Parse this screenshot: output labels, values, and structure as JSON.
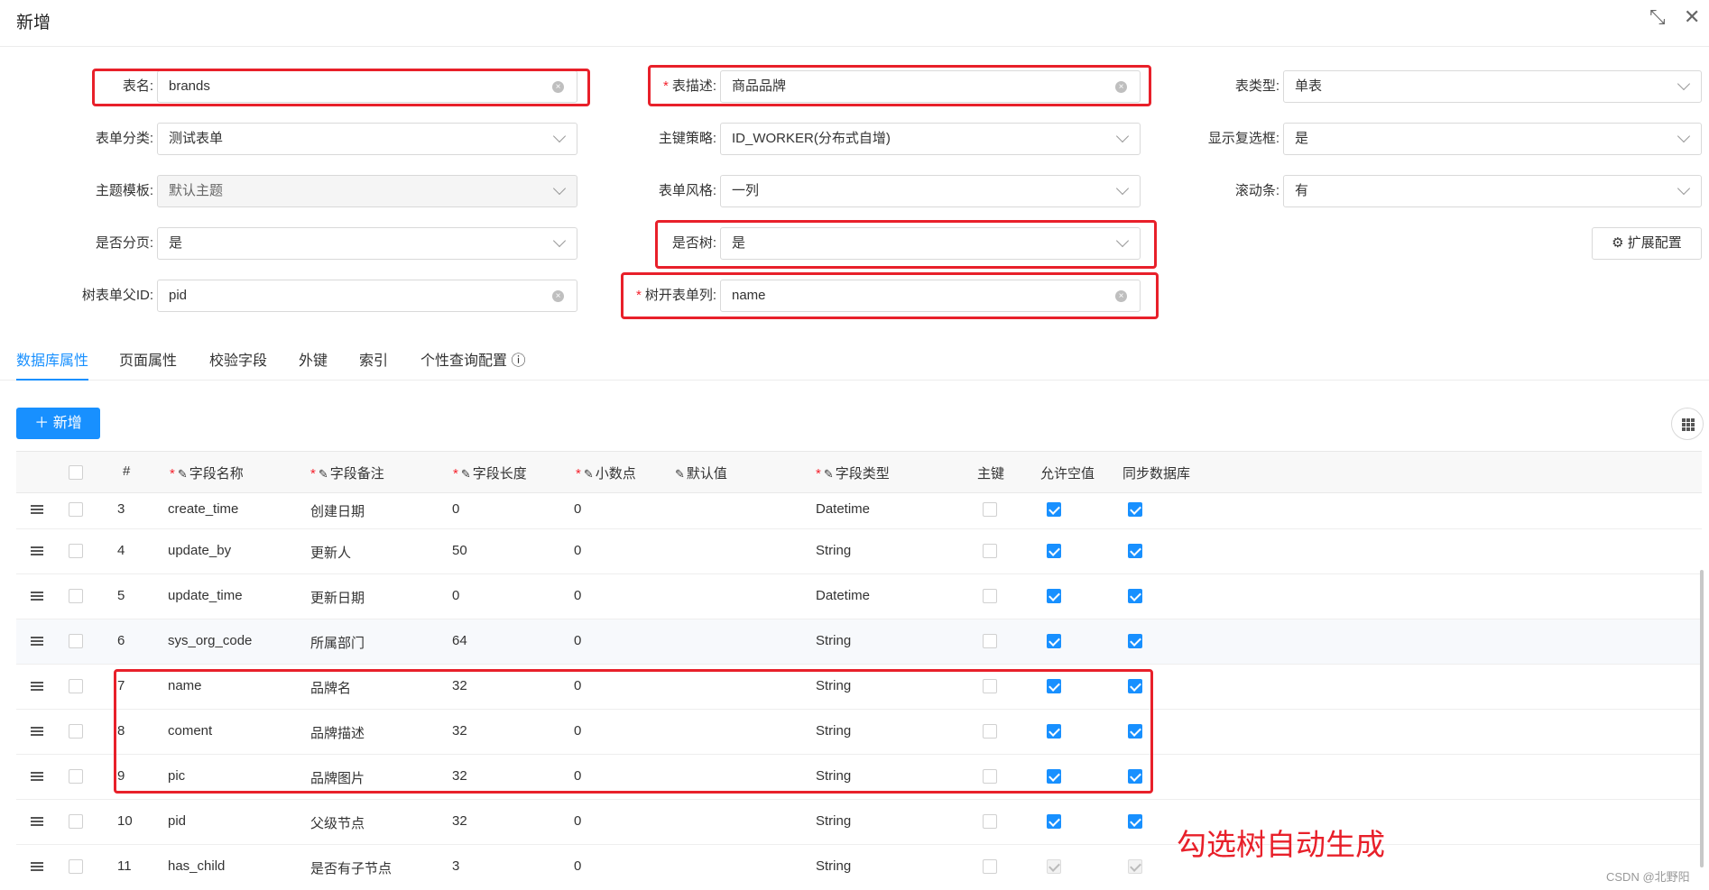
{
  "modal": {
    "title": "新增"
  },
  "form": {
    "table_name": {
      "label": "表名:",
      "value": "brands"
    },
    "table_desc": {
      "label": "表描述:",
      "value": "商品品牌"
    },
    "table_type": {
      "label": "表类型:",
      "value": "单表"
    },
    "form_category": {
      "label": "表单分类:",
      "value": "测试表单"
    },
    "pk_strategy": {
      "label": "主键策略:",
      "value": "ID_WORKER(分布式自增)"
    },
    "show_checkbox": {
      "label": "显示复选框:",
      "value": "是"
    },
    "theme": {
      "label": "主题模板:",
      "value": "默认主题"
    },
    "form_style": {
      "label": "表单风格:",
      "value": "一列"
    },
    "scrollbar": {
      "label": "滚动条:",
      "value": "有"
    },
    "paging": {
      "label": "是否分页:",
      "value": "是"
    },
    "is_tree": {
      "label": "是否树:",
      "value": "是"
    },
    "ext_config": {
      "label": "扩展配置"
    },
    "tree_parent": {
      "label": "树表单父ID:",
      "value": "pid"
    },
    "tree_col": {
      "label": "树开表单列:",
      "value": "name"
    }
  },
  "tabs": [
    "数据库属性",
    "页面属性",
    "校验字段",
    "外键",
    "索引",
    "个性查询配置"
  ],
  "toolbar": {
    "add_label": "新增"
  },
  "table": {
    "headers": {
      "index": "#",
      "field_name": "字段名称",
      "field_comment": "字段备注",
      "field_length": "字段长度",
      "decimal": "小数点",
      "default_value": "默认值",
      "field_type": "字段类型",
      "primary_key": "主键",
      "nullable": "允许空值",
      "sync_db": "同步数据库"
    },
    "rows": [
      {
        "no": "3",
        "name": "create_time",
        "comment": "创建日期",
        "length": "0",
        "decimal": "0",
        "type": "Datetime",
        "pk": false,
        "nullable": true,
        "sync": true
      },
      {
        "no": "4",
        "name": "update_by",
        "comment": "更新人",
        "length": "50",
        "decimal": "0",
        "type": "String",
        "pk": false,
        "nullable": true,
        "sync": true
      },
      {
        "no": "5",
        "name": "update_time",
        "comment": "更新日期",
        "length": "0",
        "decimal": "0",
        "type": "Datetime",
        "pk": false,
        "nullable": true,
        "sync": true
      },
      {
        "no": "6",
        "name": "sys_org_code",
        "comment": "所属部门",
        "length": "64",
        "decimal": "0",
        "type": "String",
        "pk": false,
        "nullable": true,
        "sync": true
      },
      {
        "no": "7",
        "name": "name",
        "comment": "品牌名",
        "length": "32",
        "decimal": "0",
        "type": "String",
        "pk": false,
        "nullable": true,
        "sync": true
      },
      {
        "no": "8",
        "name": "coment",
        "comment": "品牌描述",
        "length": "32",
        "decimal": "0",
        "type": "String",
        "pk": false,
        "nullable": true,
        "sync": true
      },
      {
        "no": "9",
        "name": "pic",
        "comment": "品牌图片",
        "length": "32",
        "decimal": "0",
        "type": "String",
        "pk": false,
        "nullable": true,
        "sync": true
      },
      {
        "no": "10",
        "name": "pid",
        "comment": "父级节点",
        "length": "32",
        "decimal": "0",
        "type": "String",
        "pk": false,
        "nullable": true,
        "sync": true
      },
      {
        "no": "11",
        "name": "has_child",
        "comment": "是否有子节点",
        "length": "3",
        "decimal": "0",
        "type": "String",
        "pk": false,
        "nullable": true,
        "sync": true
      }
    ]
  },
  "annotation": "勾选树自动生成",
  "watermark": "CSDN @北野阳",
  "colors": {
    "accent": "#1890ff",
    "highlight_red": "#e8202a"
  }
}
